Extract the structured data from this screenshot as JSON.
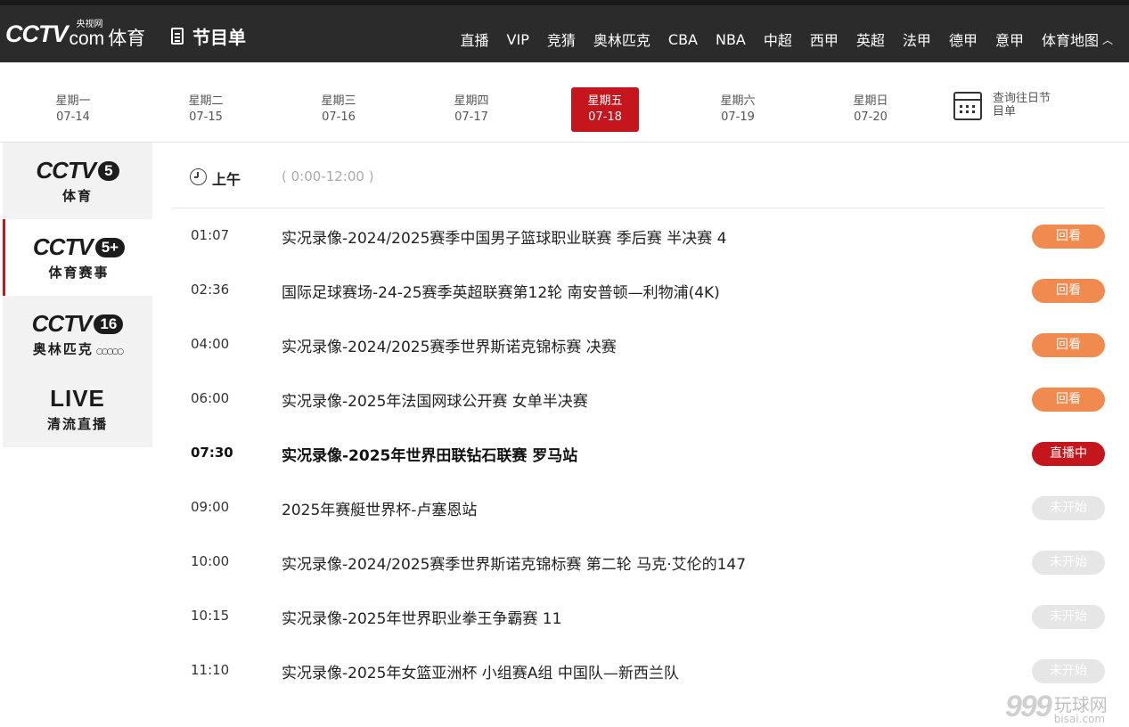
{
  "header": {
    "logo_cctv": "CCTV",
    "logo_yangshi": "央视网",
    "logo_com": "com",
    "logo_sport": "体育",
    "program_label": "节目单",
    "nav": [
      "直播",
      "VIP",
      "竞猜",
      "奥林匹克",
      "CBA",
      "NBA",
      "中超",
      "西甲",
      "英超",
      "法甲",
      "德甲",
      "意甲",
      "体育地图"
    ],
    "nav_caret": "︿"
  },
  "days": [
    {
      "weekday": "星期一",
      "date": "07-14",
      "active": false
    },
    {
      "weekday": "星期二",
      "date": "07-15",
      "active": false
    },
    {
      "weekday": "星期三",
      "date": "07-16",
      "active": false
    },
    {
      "weekday": "星期四",
      "date": "07-17",
      "active": false
    },
    {
      "weekday": "星期五",
      "date": "07-18",
      "active": true
    },
    {
      "weekday": "星期六",
      "date": "07-19",
      "active": false
    },
    {
      "weekday": "星期日",
      "date": "07-20",
      "active": false
    }
  ],
  "history": {
    "label": "查询往日节目单"
  },
  "channels": [
    {
      "brand": "CCTV",
      "num": "5",
      "sub": "体育",
      "active": false
    },
    {
      "brand": "CCTV",
      "num": "5+",
      "sub": "体育赛事",
      "active": true
    },
    {
      "brand": "CCTV",
      "num": "16",
      "sub": "奥林匹克",
      "active": false
    },
    {
      "brand": "LIVE",
      "sub": "清流直播",
      "active": false
    }
  ],
  "period": {
    "label": "上午",
    "range": "( 0:00-12:00 )"
  },
  "programs": [
    {
      "time": "01:07",
      "title": "实况录像-2024/2025赛季中国男子篮球职业联赛 季后赛 半决赛 4",
      "status": "回看",
      "type": "replay"
    },
    {
      "time": "02:36",
      "title": "国际足球赛场-24-25赛季英超联赛第12轮 南安普顿—利物浦(4K)",
      "status": "回看",
      "type": "replay"
    },
    {
      "time": "04:00",
      "title": "实况录像-2024/2025赛季世界斯诺克锦标赛 决赛",
      "status": "回看",
      "type": "replay"
    },
    {
      "time": "06:00",
      "title": "实况录像-2025年法国网球公开赛 女单半决赛",
      "status": "回看",
      "type": "replay"
    },
    {
      "time": "07:30",
      "title": "实况录像-2025年世界田联钻石联赛 罗马站",
      "status": "直播中",
      "type": "live"
    },
    {
      "time": "09:00",
      "title": "2025年赛艇世界杯-卢塞恩站",
      "status": "未开始",
      "type": "upcoming"
    },
    {
      "time": "10:00",
      "title": "实况录像-2024/2025赛季世界斯诺克锦标赛 第二轮 马克·艾伦的147",
      "status": "未开始",
      "type": "upcoming"
    },
    {
      "time": "10:15",
      "title": "实况录像-2025年世界职业拳王争霸赛 11",
      "status": "未开始",
      "type": "upcoming"
    },
    {
      "time": "11:10",
      "title": "实况录像-2025年女篮亚洲杯 小组赛A组 中国队—新西兰队",
      "status": "未开始",
      "type": "upcoming"
    }
  ],
  "watermark": {
    "num": "999",
    "cn": "玩球网",
    "url": "bisai.com"
  },
  "colors": {
    "accent": "#c4161c",
    "replay": "#f18a4e",
    "upcoming": "#e6e6e6",
    "topbar": "#2b2b2b"
  }
}
